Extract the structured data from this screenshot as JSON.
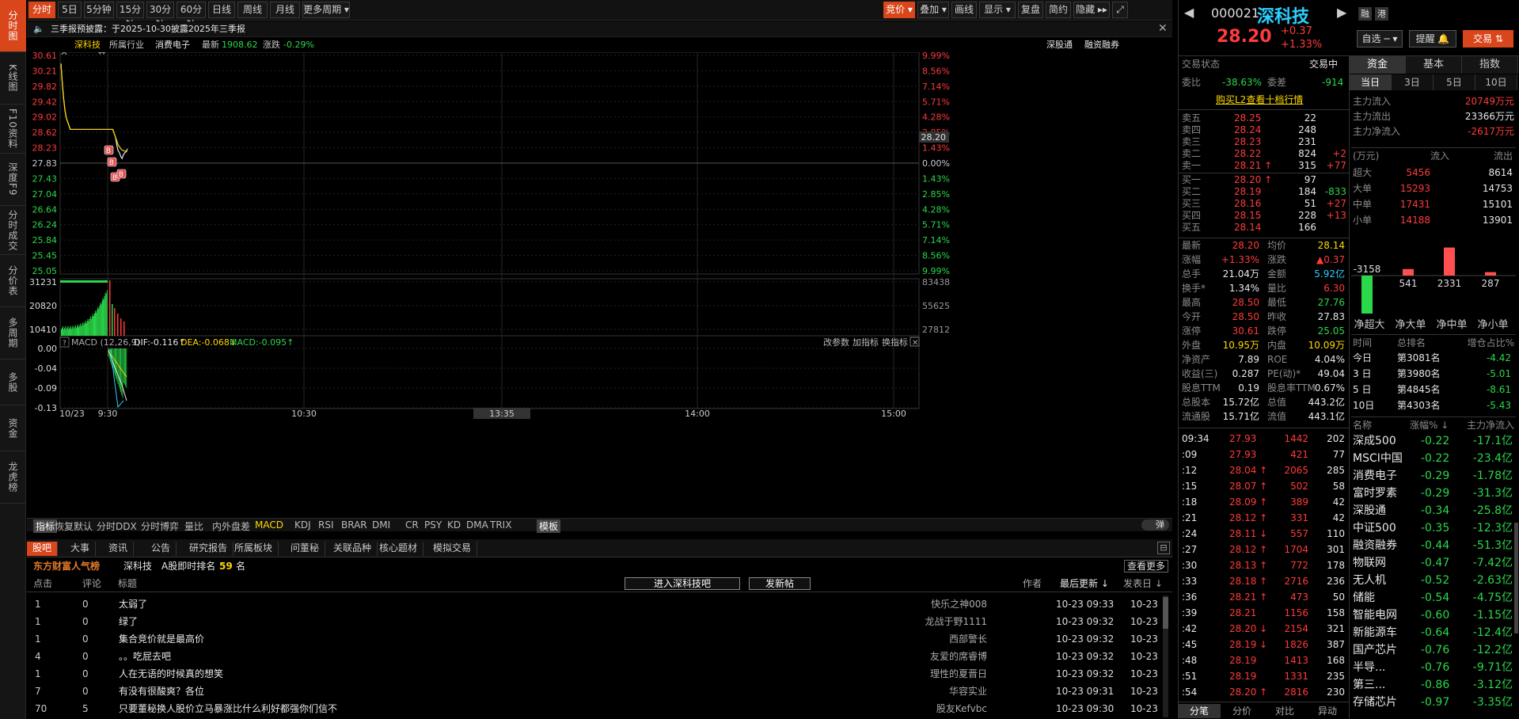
{
  "left_nav": [
    "分时图",
    "K线图",
    "F10资料",
    "深度F9",
    "分时成交",
    "分价表",
    "多周期",
    "多股",
    "资金",
    "龙虎榜"
  ],
  "toolbar": {
    "periods": [
      "分时",
      "5日 ▾",
      "5分钟",
      "15分钟",
      "30分钟",
      "60分钟",
      "日线",
      "周线",
      "月线",
      "更多周期 ▾"
    ],
    "right": [
      "竞价 ▾",
      "叠加 ▾",
      "画线",
      "显示 ▾",
      "复盘",
      "简约",
      "隐藏 ▸▸"
    ]
  },
  "notice": {
    "text": "三季报预披露：于2025-10-30披露2025年三季报"
  },
  "info_bar": {
    "name": "深科技",
    "industry_label": "所属行业",
    "industry": "消费电子",
    "latest_label": "最新",
    "latest": "1908.62",
    "chg_label": "涨跌",
    "chg": "-0.29%",
    "right1": "深股通",
    "right2": "融资融券"
  },
  "price_axis_left": [
    "30.61",
    "30.21",
    "29.82",
    "29.42",
    "29.02",
    "28.62",
    "28.23",
    "27.83",
    "27.43",
    "27.04",
    "26.64",
    "26.24",
    "25.84",
    "25.45",
    "25.05"
  ],
  "price_axis_right": [
    "9.99%",
    "8.56%",
    "7.14%",
    "5.71%",
    "4.28%",
    "2.85%",
    "1.43%",
    "0.00%",
    "1.43%",
    "2.85%",
    "4.28%",
    "5.71%",
    "7.14%",
    "8.56%",
    "9.99%"
  ],
  "current_price_tag": "28.20",
  "volume_axis_left": [
    "31231",
    "20820",
    "10410"
  ],
  "volume_axis_right": [
    "83438",
    "55625",
    "27812"
  ],
  "macd": {
    "label": "MACD (12,26,9)",
    "dif": "DIF:-0.116↑",
    "dea": "DEA:-0.068↓",
    "macd": "MACD:-0.095↑",
    "btns": [
      "改参数",
      "加指标",
      "换指标"
    ],
    "axis": [
      "0.00",
      "-0.04",
      "-0.09",
      "-0.13"
    ]
  },
  "time_axis": [
    "10/23",
    "9:30",
    "10:30",
    "13:35",
    "14:00",
    "15:00"
  ],
  "indicator_tabs": [
    "指标",
    "恢复默认",
    "分时DDX",
    "分时博弈",
    "量比",
    "内外盘差",
    "MACD",
    "KDJ",
    "RSI",
    "BRAR",
    "DMI",
    "CR",
    "PSY",
    "KD",
    "DMA",
    "TRIX",
    "模板"
  ],
  "popup_label": "弹",
  "chart_data": {
    "type": "line",
    "title": "",
    "xlabel": "",
    "ylabel": "",
    "ylim": [
      25.05,
      30.61
    ],
    "prev_close": 27.83,
    "series": [
      {
        "values": [
          30.4,
          29.9,
          29.5,
          29.2,
          29.0,
          28.9,
          28.8,
          28.7,
          28.7,
          28.7,
          28.7,
          28.7,
          28.7,
          28.7,
          28.7,
          28.7,
          28.7,
          28.7,
          28.7,
          28.7,
          28.7,
          28.7,
          28.7,
          28.7,
          28.7,
          28.7,
          28.7,
          28.7,
          28.7,
          28.7,
          28.7,
          28.7,
          28.7,
          28.7,
          28.7,
          28.7,
          28.7,
          28.7,
          28.7,
          28.7,
          28.6,
          28.5,
          28.3,
          28.15,
          28.1,
          28.0,
          27.95,
          28.05,
          28.1,
          28.12,
          28.2
        ]
      },
      {
        "values": [
          30.4,
          29.9,
          29.5,
          29.2,
          29.0,
          28.9,
          28.8,
          28.7,
          28.7,
          28.7,
          28.7,
          28.7,
          28.7,
          28.7,
          28.7,
          28.7,
          28.7,
          28.7,
          28.7,
          28.7,
          28.7,
          28.7,
          28.7,
          28.7,
          28.7,
          28.7,
          28.7,
          28.7,
          28.7,
          28.7,
          28.7,
          28.7,
          28.7,
          28.7,
          28.7,
          28.7,
          28.7,
          28.7,
          28.7,
          28.7,
          28.6,
          28.5,
          28.4,
          28.3,
          28.25,
          28.2,
          28.17,
          28.15,
          28.14,
          28.14,
          28.14
        ]
      }
    ]
  },
  "gb": {
    "tabs": [
      "股吧",
      "大事",
      "资讯",
      "公告",
      "研究报告",
      "所属板块",
      "问董秘",
      "关联品种",
      "核心题材",
      "模拟交易"
    ],
    "rank_title": "东方财富人气榜",
    "rank_stock": "深科技",
    "rank_label": "A股即时排名",
    "rank": "59",
    "rank_unit": "名",
    "more": "查看更多",
    "cols": [
      "点击",
      "评论",
      "标题",
      "作者",
      "最后更新 ↓",
      "发表日 ↓"
    ],
    "btn_enter": "进入深科技吧",
    "btn_post": "发新帖",
    "posts": [
      [
        "1",
        "0",
        "太弱了",
        "快乐之神008",
        "10-23 09:33",
        "10-23"
      ],
      [
        "1",
        "0",
        "绿了",
        "龙战于野1111",
        "10-23 09:32",
        "10-23"
      ],
      [
        "1",
        "0",
        "集合竞价就是最高价",
        "西部警长",
        "10-23 09:32",
        "10-23"
      ],
      [
        "4",
        "0",
        "。。吃屁去吧",
        "友爱的席睿博",
        "10-23 09:32",
        "10-23"
      ],
      [
        "1",
        "0",
        "人在无语的时候真的想笑",
        "理性的夏晋日",
        "10-23 09:32",
        "10-23"
      ],
      [
        "7",
        "0",
        "有没有很酸爽？各位",
        "华容实业",
        "10-23 09:31",
        "10-23"
      ],
      [
        "70",
        "5",
        "只要董秘换人股价立马暴涨比什么利好都强你们信不",
        "股友Kefvbc",
        "10-23 09:30",
        "10-23"
      ]
    ]
  },
  "quote": {
    "code": "000021",
    "name": "深科技",
    "price": "28.20",
    "chg": "+0.37",
    "pct": "+1.33%",
    "tag1": "融",
    "tag2": "港",
    "btn_zixuan": "自选 ─ ▾",
    "btn_tixing": "提醒 🔔",
    "btn_jiaoyi": "交易 ⇅",
    "status_label": "交易状态",
    "status": "交易中",
    "wb_label": "委比",
    "wb": "-38.63%",
    "wc_label": "委差",
    "wc": "-914",
    "l2": "购买L2查看十档行情",
    "sell": [
      [
        "卖五",
        "28.25",
        "22",
        ""
      ],
      [
        "卖四",
        "28.24",
        "248",
        ""
      ],
      [
        "卖三",
        "28.23",
        "231",
        ""
      ],
      [
        "卖二",
        "28.22",
        "824",
        "+2"
      ],
      [
        "卖一",
        "28.21 ↑",
        "315",
        "+77"
      ]
    ],
    "buy": [
      [
        "买一",
        "28.20 ↑",
        "97",
        ""
      ],
      [
        "买二",
        "28.19",
        "184",
        "-833"
      ],
      [
        "买三",
        "28.16",
        "51",
        "+27"
      ],
      [
        "买四",
        "28.15",
        "228",
        "+13"
      ],
      [
        "买五",
        "28.14",
        "166",
        ""
      ]
    ],
    "stats": [
      [
        "最新",
        "28.20",
        "均价",
        "28.14"
      ],
      [
        "涨幅",
        "+1.33%",
        "涨跌",
        "▲0.37"
      ],
      [
        "总手",
        "21.04万",
        "金额",
        "5.92亿"
      ],
      [
        "换手*",
        "1.34%",
        "量比",
        "6.30"
      ],
      [
        "最高",
        "28.50",
        "最低",
        "27.76"
      ],
      [
        "今开",
        "28.50",
        "昨收",
        "27.83"
      ],
      [
        "涨停",
        "30.61",
        "跌停",
        "25.05"
      ],
      [
        "外盘",
        "10.95万",
        "内盘",
        "10.09万"
      ],
      [
        "净资产",
        "7.89",
        "ROE",
        "4.04%"
      ],
      [
        "收益(三)",
        "0.287",
        "PE(动)*",
        "49.04"
      ],
      [
        "股息TTM",
        "0.19",
        "股息率TTM",
        "0.67%"
      ],
      [
        "总股本",
        "15.72亿",
        "总值",
        "443.2亿"
      ],
      [
        "流通股",
        "15.71亿",
        "流值",
        "443.1亿"
      ]
    ],
    "ticks": [
      [
        "09:34",
        "27.93",
        "1442",
        "202"
      ],
      [
        ":09",
        "27.93",
        "421",
        "77"
      ],
      [
        ":12",
        "28.04 ↑",
        "2065",
        "285"
      ],
      [
        ":15",
        "28.07 ↑",
        "502",
        "58"
      ],
      [
        ":18",
        "28.09 ↑",
        "389",
        "42"
      ],
      [
        ":21",
        "28.12 ↑",
        "331",
        "42"
      ],
      [
        ":24",
        "28.11 ↓",
        "557",
        "110"
      ],
      [
        ":27",
        "28.12 ↑",
        "1704",
        "301"
      ],
      [
        ":30",
        "28.13 ↑",
        "772",
        "178"
      ],
      [
        ":33",
        "28.18 ↑",
        "2716",
        "236"
      ],
      [
        ":36",
        "28.21 ↑",
        "473",
        "50"
      ],
      [
        ":39",
        "28.21",
        "1156",
        "158"
      ],
      [
        ":42",
        "28.20 ↓",
        "2154",
        "321"
      ],
      [
        ":45",
        "28.19 ↓",
        "1826",
        "387"
      ],
      [
        ":48",
        "28.19",
        "1413",
        "168"
      ],
      [
        ":51",
        "28.19",
        "1331",
        "235"
      ],
      [
        ":54",
        "28.20 ↑",
        "2816",
        "230"
      ]
    ],
    "bottom_tabs": [
      "分笔",
      "分价",
      "对比",
      "异动"
    ]
  },
  "fund": {
    "tabs": [
      "资金",
      "基本",
      "指数"
    ],
    "subtabs": [
      "当日",
      "3日",
      "5日",
      "10日"
    ],
    "flows": [
      [
        "主力流入",
        "20749万元"
      ],
      [
        "主力流出",
        "23366万元"
      ],
      [
        "主力净流入",
        "-2617万元"
      ]
    ],
    "unit": "(万元)",
    "in_label": "流入",
    "out_label": "流出",
    "table": [
      [
        "超大",
        "5456",
        "8614"
      ],
      [
        "大单",
        "15293",
        "14753"
      ],
      [
        "中单",
        "17431",
        "15101"
      ],
      [
        "小单",
        "14188",
        "13901"
      ]
    ],
    "net": [
      {
        "label": "净超大",
        "value": -3158
      },
      {
        "label": "净大单",
        "value": 541
      },
      {
        "label": "净中单",
        "value": 2331
      },
      {
        "label": "净小单",
        "value": 287
      }
    ],
    "rank_cols": [
      "时间",
      "总排名",
      "增仓占比%"
    ],
    "ranks": [
      [
        "今日",
        "第3081名",
        "-4.42"
      ],
      [
        "3 日",
        "第3980名",
        "-5.01"
      ],
      [
        "5 日",
        "第4845名",
        "-8.61"
      ],
      [
        "10日",
        "第4303名",
        "-5.43"
      ]
    ],
    "sector_cols": [
      "名称",
      "涨幅% ↓",
      "主力净流入"
    ],
    "sectors": [
      [
        "深成500",
        "-0.22",
        "-17.1亿"
      ],
      [
        "MSCI中国",
        "-0.22",
        "-23.4亿"
      ],
      [
        "消费电子",
        "-0.29",
        "-1.78亿"
      ],
      [
        "富时罗素",
        "-0.29",
        "-31.3亿"
      ],
      [
        "深股通",
        "-0.34",
        "-25.8亿"
      ],
      [
        "中证500",
        "-0.35",
        "-12.3亿"
      ],
      [
        "融资融券",
        "-0.44",
        "-51.3亿"
      ],
      [
        "物联网",
        "-0.47",
        "-7.42亿"
      ],
      [
        "无人机",
        "-0.52",
        "-2.63亿"
      ],
      [
        "储能",
        "-0.54",
        "-4.75亿"
      ],
      [
        "智能电网",
        "-0.60",
        "-1.15亿"
      ],
      [
        "新能源车",
        "-0.64",
        "-12.4亿"
      ],
      [
        "国产芯片",
        "-0.76",
        "-12.2亿"
      ],
      [
        "半导...",
        "-0.76",
        "-9.71亿"
      ],
      [
        "第三...",
        "-0.86",
        "-3.12亿"
      ],
      [
        "存储芯片",
        "-0.97",
        "-3.35亿"
      ]
    ]
  }
}
